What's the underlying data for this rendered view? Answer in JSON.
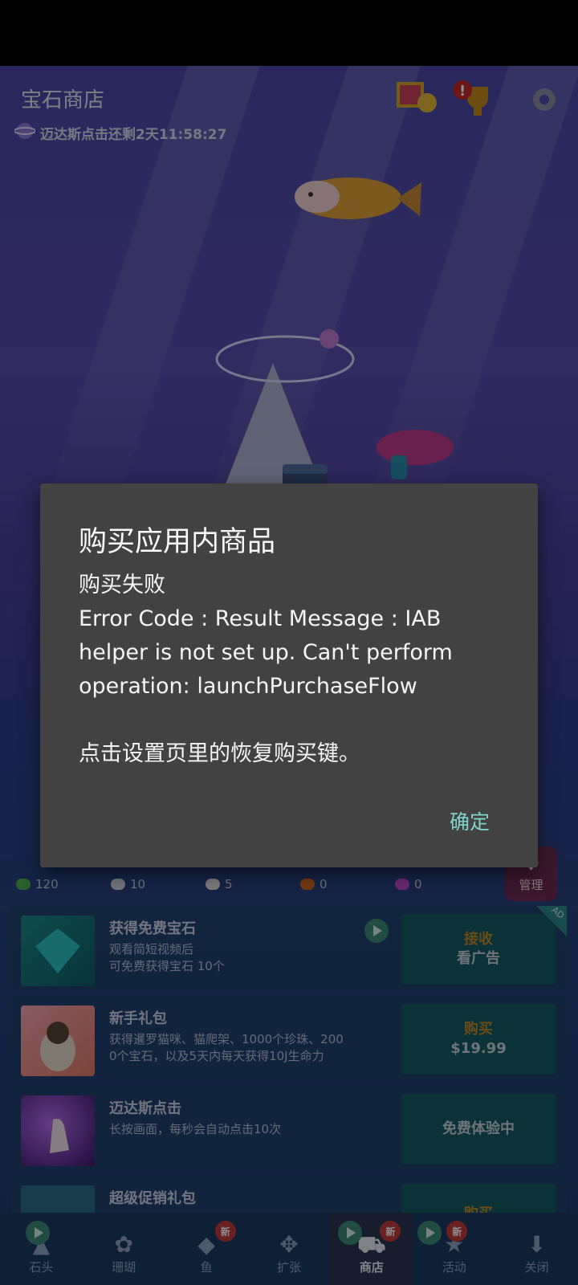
{
  "hud": {
    "title": "宝石商店",
    "timer": "迈达斯点击还剩2天11:58:27",
    "icons": [
      "photo-award-icon",
      "alert-trophy-icon",
      "gear-icon"
    ]
  },
  "stats": [
    {
      "icon": "leaf-icon",
      "value": "120",
      "color": "#4caf50"
    },
    {
      "icon": "stone-icon",
      "value": "10",
      "color": "#cfd6e0"
    },
    {
      "icon": "shell-icon",
      "value": "5",
      "color": "#e0e0e0"
    },
    {
      "icon": "orange-fish-icon",
      "value": "0",
      "color": "#d2691e"
    },
    {
      "icon": "seahorse-icon",
      "value": "0",
      "color": "#c04bd0"
    }
  ],
  "manage_label": "管理",
  "shop": {
    "items": [
      {
        "title": "获得免费宝石",
        "desc": "观看简短视频后\n可免费获得宝石 10个",
        "btn_top": "接收",
        "btn_bottom": "看广告",
        "badge": "AD"
      },
      {
        "title": "新手礼包",
        "desc": "获得暹罗猫咪、猫爬架、1000个珍珠、200\n0个宝石，以及5天内每天获得10J生命力",
        "btn_top": "购买",
        "btn_bottom": "$19.99"
      },
      {
        "title": "迈达斯点击",
        "desc": "长按画面，每秒会自动点击10次",
        "btn_top": "",
        "btn_bottom": "免费体验中"
      },
      {
        "title": "超级促销礼包",
        "desc": "",
        "btn_top": "",
        "btn_bottom": "购买"
      }
    ]
  },
  "nav": {
    "items": [
      {
        "label": "石头",
        "glyph": "▲",
        "badge": "",
        "play": true
      },
      {
        "label": "珊瑚",
        "glyph": "✿",
        "badge": "",
        "play": false
      },
      {
        "label": "鱼",
        "glyph": "◆",
        "badge": "新",
        "play": false
      },
      {
        "label": "扩张",
        "glyph": "✥",
        "badge": "",
        "play": false
      },
      {
        "label": "商店",
        "glyph": "⛟",
        "badge": "新",
        "play": true
      },
      {
        "label": "活动",
        "glyph": "★",
        "badge": "新",
        "play": true
      },
      {
        "label": "关闭",
        "glyph": "⬇",
        "badge": "",
        "play": false
      }
    ]
  },
  "dialog": {
    "title": "购买应用内商品",
    "body": "购买失败\nError Code : Result Message : IAB helper is not set up. Can't perform operation: launchPurchaseFlow\n\n点击设置页里的恢复购买键。",
    "ok_label": "确定"
  }
}
